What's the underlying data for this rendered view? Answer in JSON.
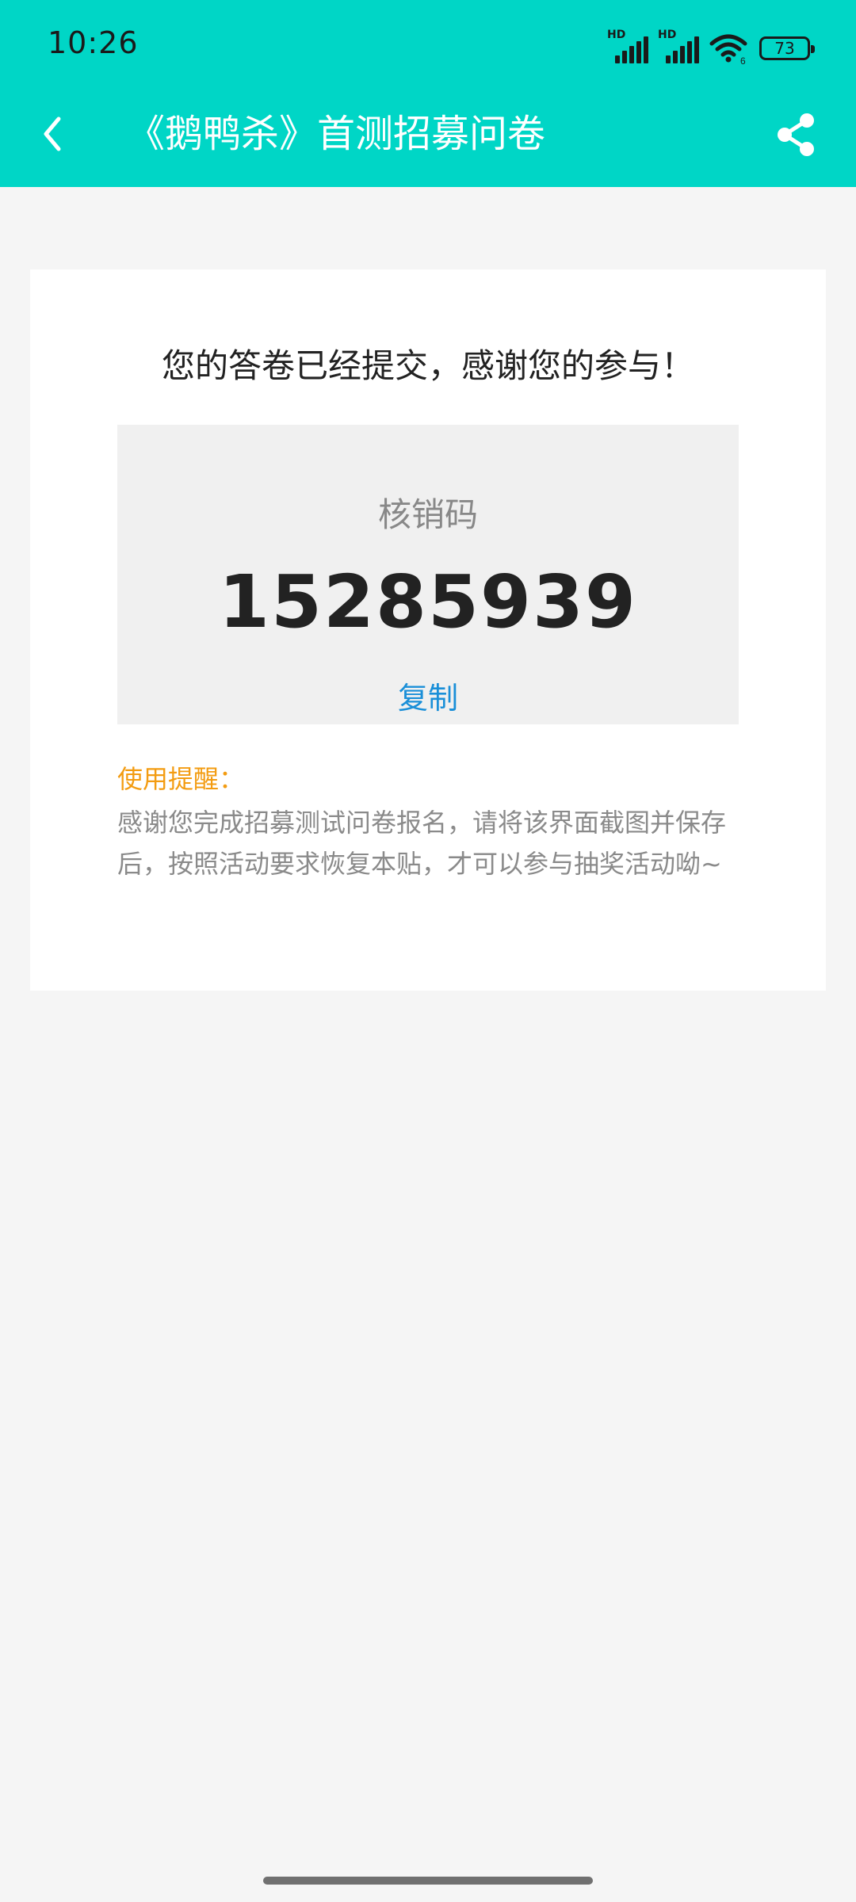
{
  "status_bar": {
    "time": "10:26",
    "signal1_label": "HD",
    "signal2_label": "HD",
    "wifi_label": "6",
    "battery_level": "73",
    "icons": [
      "signal-icon",
      "signal-icon",
      "wifi-icon",
      "battery-icon"
    ]
  },
  "nav": {
    "back_icon": "chevron-left-icon",
    "title": "《鹅鸭杀》首测招募问卷",
    "share_icon": "share-icon"
  },
  "card": {
    "heading": "您的答卷已经提交，感谢您的参与！",
    "code_label": "核销码",
    "code_value": "15285939",
    "copy_label": "复制",
    "tip_title": "使用提醒：",
    "tip_text": "感谢您完成招募测试问卷报名，请将该界面截图并保存后，按照活动要求恢复本贴，才可以参与抽奖活动呦~"
  },
  "colors": {
    "header_bg": "#00d6c6",
    "page_bg": "#f5f5f5",
    "copy_link": "#1a8fd8",
    "tip_title": "#f39c12"
  }
}
